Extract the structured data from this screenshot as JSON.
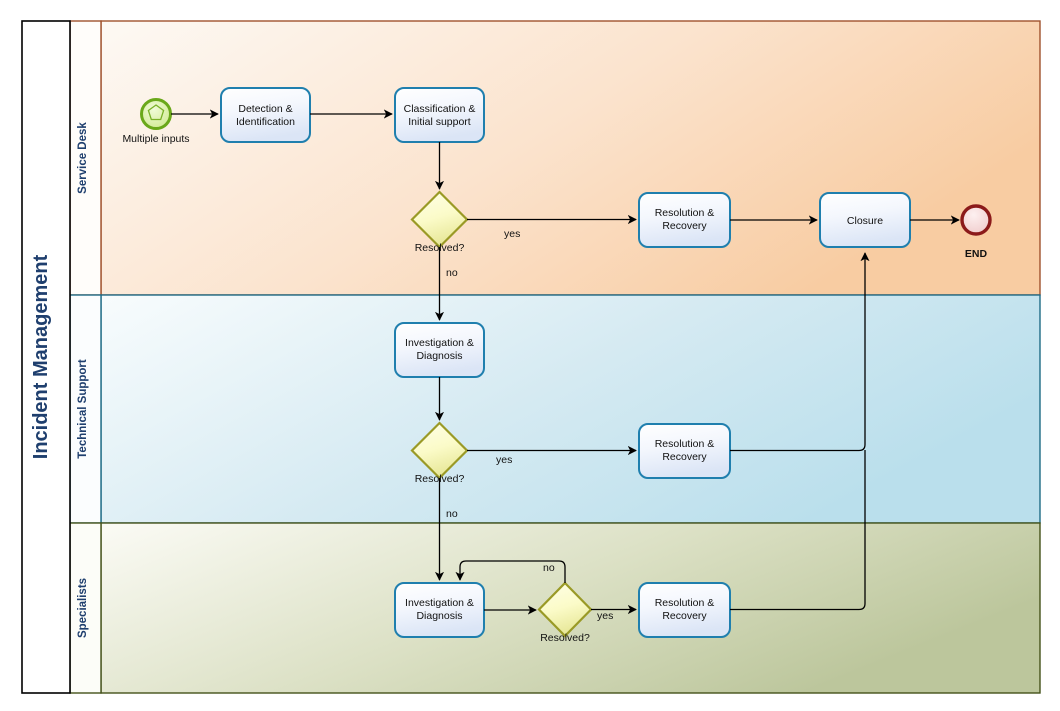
{
  "diagram": {
    "type": "bpmn-swimlane",
    "pool_title": "Incident Management",
    "lanes": [
      {
        "id": "service-desk",
        "label": "Service Desk",
        "accent": "#a0522d",
        "fill_from": "#fdf8f2",
        "fill_to": "#f8cfa8"
      },
      {
        "id": "technical-support",
        "label": "Technical Support",
        "accent": "#1f6b86",
        "fill_from": "#f7fbfd",
        "fill_to": "#bde0ec"
      },
      {
        "id": "specialists",
        "label": "Specialists",
        "accent": "#44521a",
        "fill_from": "#fbfbf6",
        "fill_to": "#bfc89e"
      }
    ],
    "nodes": {
      "start_event": {
        "label": "Multiple inputs",
        "kind": "start-multiple",
        "stroke": "#62a618",
        "fill": "#d8ef9e"
      },
      "end_event": {
        "label": "END",
        "kind": "end",
        "stroke": "#8b1a1a",
        "fill": "#f6d5d5"
      },
      "tasks": [
        {
          "id": "detection",
          "label_line1": "Detection &",
          "label_line2": "Identification",
          "lane": "service-desk"
        },
        {
          "id": "classification",
          "label_line1": "Classification &",
          "label_line2": "Initial support",
          "lane": "service-desk"
        },
        {
          "id": "resolution1",
          "label_line1": "Resolution &",
          "label_line2": "Recovery",
          "lane": "service-desk"
        },
        {
          "id": "closure",
          "label_line1": "Closure",
          "label_line2": "",
          "lane": "service-desk"
        },
        {
          "id": "investigation2",
          "label_line1": "Investigation &",
          "label_line2": "Diagnosis",
          "lane": "technical-support"
        },
        {
          "id": "resolution2",
          "label_line1": "Resolution &",
          "label_line2": "Recovery",
          "lane": "technical-support"
        },
        {
          "id": "investigation3",
          "label_line1": "Investigation &",
          "label_line2": "Diagnosis",
          "lane": "specialists"
        },
        {
          "id": "resolution3",
          "label_line1": "Resolution &",
          "label_line2": "Recovery",
          "lane": "specialists"
        }
      ],
      "gateways": [
        {
          "id": "gw1",
          "label": "Resolved?",
          "lane": "service-desk"
        },
        {
          "id": "gw2",
          "label": "Resolved?",
          "lane": "technical-support"
        },
        {
          "id": "gw3",
          "label": "Resolved?",
          "lane": "specialists"
        }
      ]
    },
    "flow_labels": {
      "gw1_yes": "yes",
      "gw1_no": "no",
      "gw2_yes": "yes",
      "gw2_no": "no",
      "gw3_yes": "yes",
      "gw3_no": "no"
    },
    "colors": {
      "task_stroke": "#1f7fae",
      "task_fill_from": "#ffffff",
      "task_fill_to": "#dde7f7",
      "gateway_stroke": "#9a9a26",
      "gateway_fill_from": "#ffffdd",
      "gateway_fill_to": "#eeeea0",
      "flow_line": "#000000",
      "title_text": "#1f3f6e",
      "lane_label_text": "#1f3f6e",
      "frame": "#000000"
    }
  }
}
